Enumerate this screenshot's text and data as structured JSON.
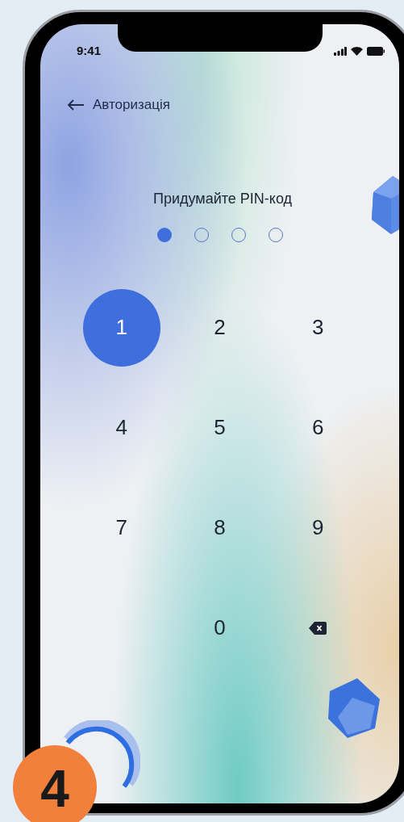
{
  "status_bar": {
    "time": "9:41"
  },
  "header": {
    "back_label": "Авторизація"
  },
  "title": "Придумайте PIN-код",
  "pin_dots": [
    {
      "filled": true
    },
    {
      "filled": false
    },
    {
      "filled": false
    },
    {
      "filled": false
    }
  ],
  "keypad": [
    {
      "kind": "digit",
      "label": "1",
      "selected": true
    },
    {
      "kind": "digit",
      "label": "2",
      "selected": false
    },
    {
      "kind": "digit",
      "label": "3",
      "selected": false
    },
    {
      "kind": "digit",
      "label": "4",
      "selected": false
    },
    {
      "kind": "digit",
      "label": "5",
      "selected": false
    },
    {
      "kind": "digit",
      "label": "6",
      "selected": false
    },
    {
      "kind": "digit",
      "label": "7",
      "selected": false
    },
    {
      "kind": "digit",
      "label": "8",
      "selected": false
    },
    {
      "kind": "digit",
      "label": "9",
      "selected": false
    },
    {
      "kind": "blank"
    },
    {
      "kind": "digit",
      "label": "0",
      "selected": false
    },
    {
      "kind": "backspace"
    }
  ],
  "step_badge": "4"
}
